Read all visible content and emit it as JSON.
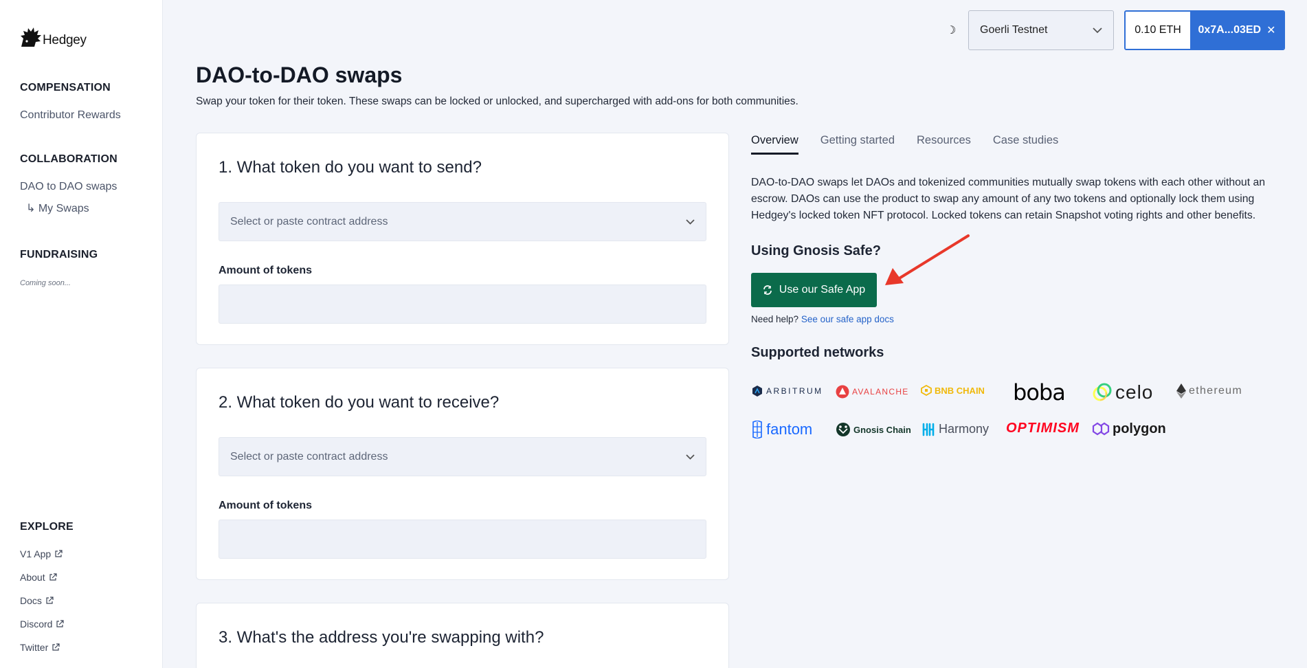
{
  "brand": {
    "name": "Hedgey"
  },
  "sidebar": {
    "sections": [
      {
        "title": "COMPENSATION"
      },
      {
        "title": "COLLABORATION"
      },
      {
        "title": "FUNDRAISING"
      },
      {
        "title": "EXPLORE"
      }
    ],
    "contributor_rewards": "Contributor Rewards",
    "dao_to_dao": "DAO to DAO swaps",
    "my_swaps": "↳ My Swaps",
    "coming_soon": "Coming soon...",
    "explore_links": [
      "V1 App",
      "About",
      "Docs",
      "Discord",
      "Twitter"
    ]
  },
  "topbar": {
    "network": "Goerli Testnet",
    "balance": "0.10 ETH",
    "address": "0x7A...03ED"
  },
  "main": {
    "title": "DAO-to-DAO swaps",
    "subtitle": "Swap your token for their token. These swaps can be locked or unlocked, and supercharged with add-ons for both communities.",
    "cards": [
      {
        "title": "1. What token do you want to send?",
        "select_placeholder": "Select or paste contract address",
        "amount_label": "Amount of tokens"
      },
      {
        "title": "2. What token do you want to receive?",
        "select_placeholder": "Select or paste contract address",
        "amount_label": "Amount of tokens"
      },
      {
        "title": "3. What's the address you're swapping with?"
      }
    ]
  },
  "info": {
    "tabs": [
      "Overview",
      "Getting started",
      "Resources",
      "Case studies"
    ],
    "overview": "DAO-to-DAO swaps let DAOs and tokenized communities mutually swap tokens with each other without an escrow. DAOs can use the product to swap any amount of any two tokens and optionally lock them using Hedgey's locked token NFT protocol. Locked tokens can retain Snapshot voting rights and other benefits.",
    "gnosis_title": "Using Gnosis Safe?",
    "safe_button": "Use our Safe App",
    "help_prefix": "Need help?",
    "help_link": "See our safe app docs",
    "networks_title": "Supported networks",
    "networks": [
      "ARBITRUM",
      "AVALANCHE",
      "BNB CHAIN",
      "boba",
      "celo",
      "ethereum",
      "fantom",
      "Gnosis Chain",
      "Harmony",
      "OPTIMISM",
      "polygon"
    ]
  },
  "colors": {
    "accent": "#2f6fd6",
    "safe_green": "#0b6b4b",
    "annotation_arrow": "#e8382a"
  }
}
